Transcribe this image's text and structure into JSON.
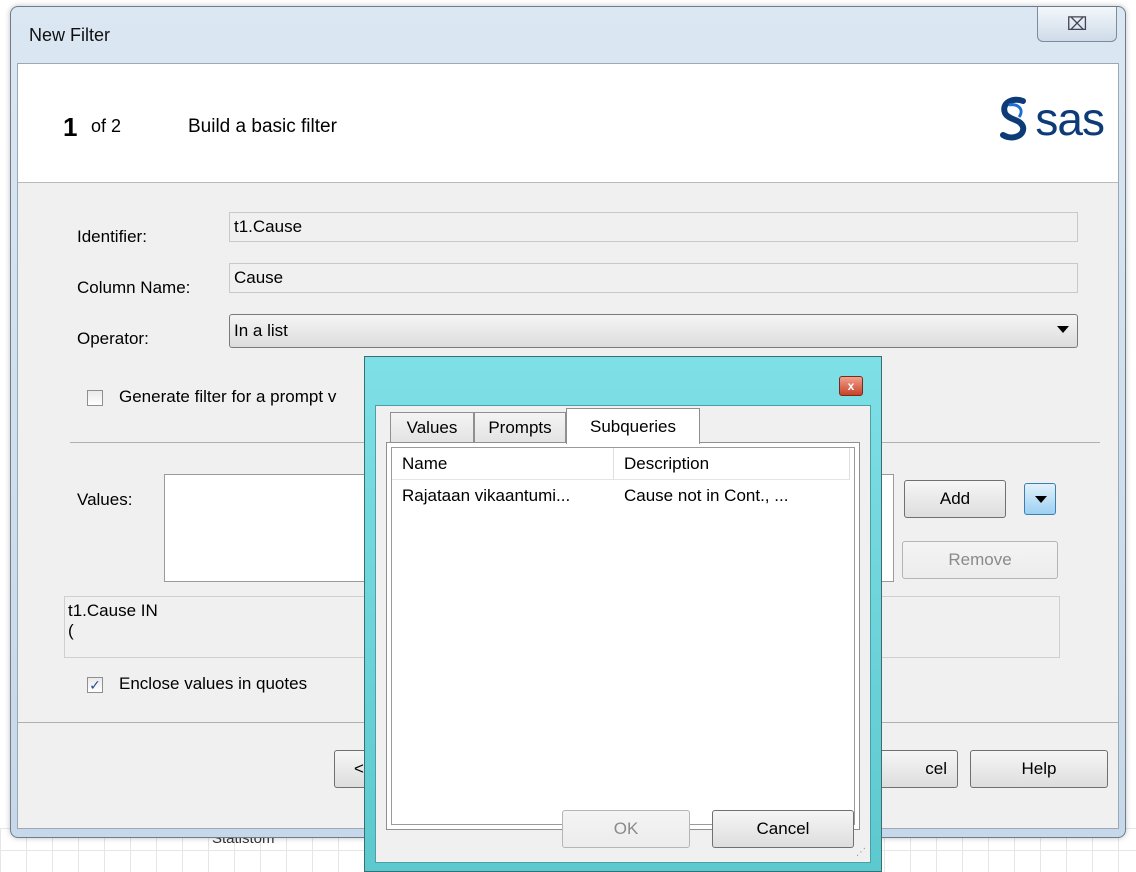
{
  "window": {
    "title": "New Filter",
    "close_glyph": "⌧"
  },
  "header": {
    "step_number": "1",
    "step_of": "of 2",
    "step_title": "Build a basic filter",
    "logo_text": "sas"
  },
  "form": {
    "identifier_label": "Identifier:",
    "identifier_value": "t1.Cause",
    "column_name_label": "Column Name:",
    "column_name_value": "Cause",
    "operator_label": "Operator:",
    "operator_value": "In a list",
    "prompt_checkbox_label": "Generate filter for a prompt v",
    "prompt_checked": false,
    "values_label": "Values:",
    "add_label": "Add",
    "remove_label": "Remove",
    "expression_line1": "t1.Cause IN",
    "expression_line2": "(",
    "quotes_checkbox_label": "Enclose values in quotes",
    "quotes_checked": true
  },
  "footer": {
    "back_partial": "<",
    "cancel_partial": "cel",
    "help_label": "Help"
  },
  "background": {
    "partial_text": "Statistom"
  },
  "popup": {
    "close_glyph": "x",
    "tabs": [
      {
        "label": "Values",
        "active": false
      },
      {
        "label": "Prompts",
        "active": false
      },
      {
        "label": "Subqueries",
        "active": true
      }
    ],
    "columns": [
      "Name",
      "Description"
    ],
    "rows": [
      {
        "name": "Rajataan vikaantumi...",
        "description": "Cause not in Cont., ..."
      }
    ],
    "ok_label": "OK",
    "cancel_label": "Cancel"
  },
  "colors": {
    "popup_frame": "#6fd6dc",
    "window_frame": "#c7d8ea",
    "logo_blue": "#0d3b78"
  }
}
